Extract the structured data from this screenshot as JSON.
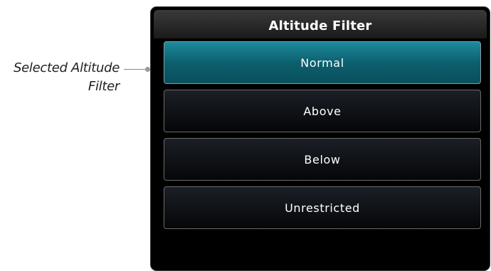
{
  "callout": {
    "line1": "Selected Altitude",
    "line2": "Filter"
  },
  "panel": {
    "title": "Altitude Filter"
  },
  "options": [
    {
      "label": "Normal",
      "selected": true
    },
    {
      "label": "Above",
      "selected": false
    },
    {
      "label": "Below",
      "selected": false
    },
    {
      "label": "Unrestricted",
      "selected": false
    }
  ],
  "colors": {
    "selected_fill": "#12788a",
    "unselected_fill": "#0f1217",
    "panel_bg": "#000000",
    "text": "#ffffff"
  }
}
